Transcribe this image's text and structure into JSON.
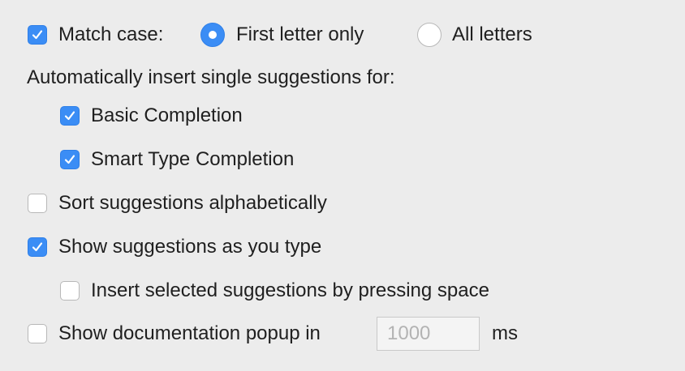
{
  "match_case": {
    "checked": true,
    "label": "Match case:",
    "options": [
      {
        "label": "First letter only",
        "selected": true
      },
      {
        "label": "All letters",
        "selected": false
      }
    ]
  },
  "auto_insert": {
    "heading": "Automatically insert single suggestions for:",
    "basic_completion": {
      "label": "Basic Completion",
      "checked": true
    },
    "smart_type_completion": {
      "label": "Smart Type Completion",
      "checked": true
    }
  },
  "sort_alphabetically": {
    "label": "Sort suggestions alphabetically",
    "checked": false
  },
  "show_as_you_type": {
    "label": "Show suggestions as you type",
    "checked": true
  },
  "insert_by_space": {
    "label": "Insert selected suggestions by pressing space",
    "checked": false
  },
  "documentation_popup": {
    "label": "Show documentation popup in",
    "checked": false,
    "delay_placeholder": "1000",
    "unit": "ms"
  },
  "colors": {
    "accent": "#3b8df5",
    "background": "#ececec"
  }
}
